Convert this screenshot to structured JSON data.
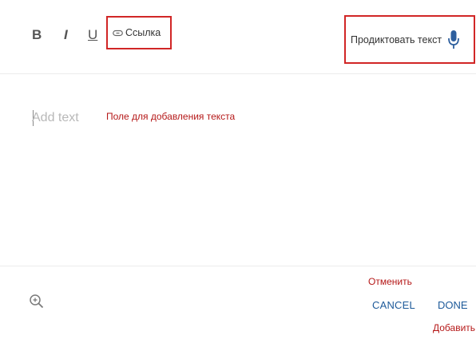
{
  "toolbar": {
    "bold_label": "B",
    "italic_label": "I",
    "underline_label": "U",
    "link_label": "Ссылка",
    "dictate_label": "Продиктовать текст"
  },
  "editor": {
    "placeholder": "Add text",
    "annotation": "Поле для добавления текста"
  },
  "footer": {
    "cancel_annotation": "Отменить",
    "cancel_label": "CANCEL",
    "done_label": "DONE",
    "done_annotation": "Добавить"
  },
  "icons": {
    "link": "link-icon",
    "microphone": "microphone-icon",
    "zoom": "zoom-in-icon"
  },
  "colors": {
    "annotation_red": "#d12626",
    "button_blue": "#1d5a9a",
    "placeholder_gray": "#b8b8b8"
  }
}
